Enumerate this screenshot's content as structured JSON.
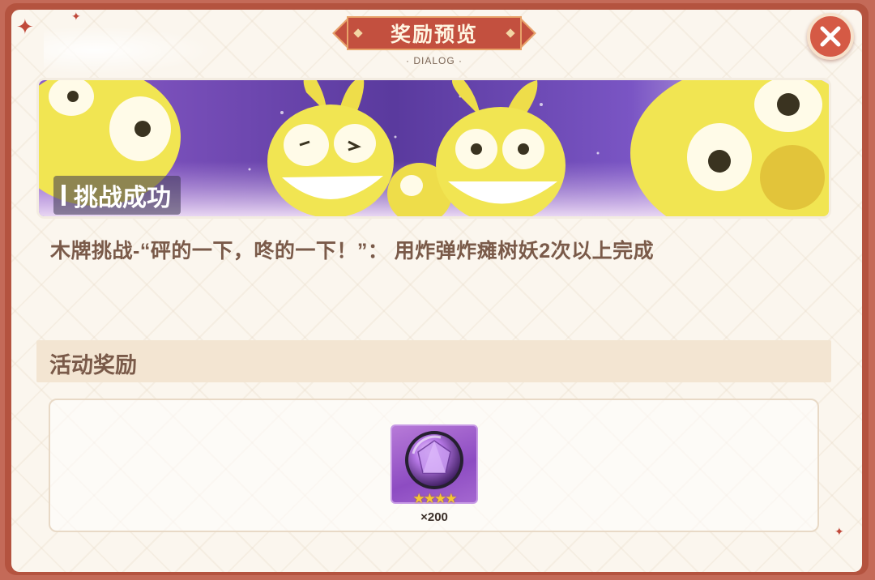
{
  "dialog": {
    "title": "奖励预览",
    "subtitle": "· DIALOG ·"
  },
  "banner": {
    "label": "挑战成功"
  },
  "task": {
    "description": "木牌挑战-“砰的一下，咚的一下！”： 用炸弹炸瘫树妖2次以上完成"
  },
  "rewards": {
    "section_title": "活动奖励",
    "items": [
      {
        "icon": "purple-gem-icon",
        "stars": 4,
        "stars_text": "★★★★",
        "quantity": "×200"
      }
    ]
  },
  "colors": {
    "frame": "#b4533f",
    "accent_red": "#c3503f",
    "text_brown": "#7a5a49",
    "panel_bg": "#fbf6ee"
  }
}
